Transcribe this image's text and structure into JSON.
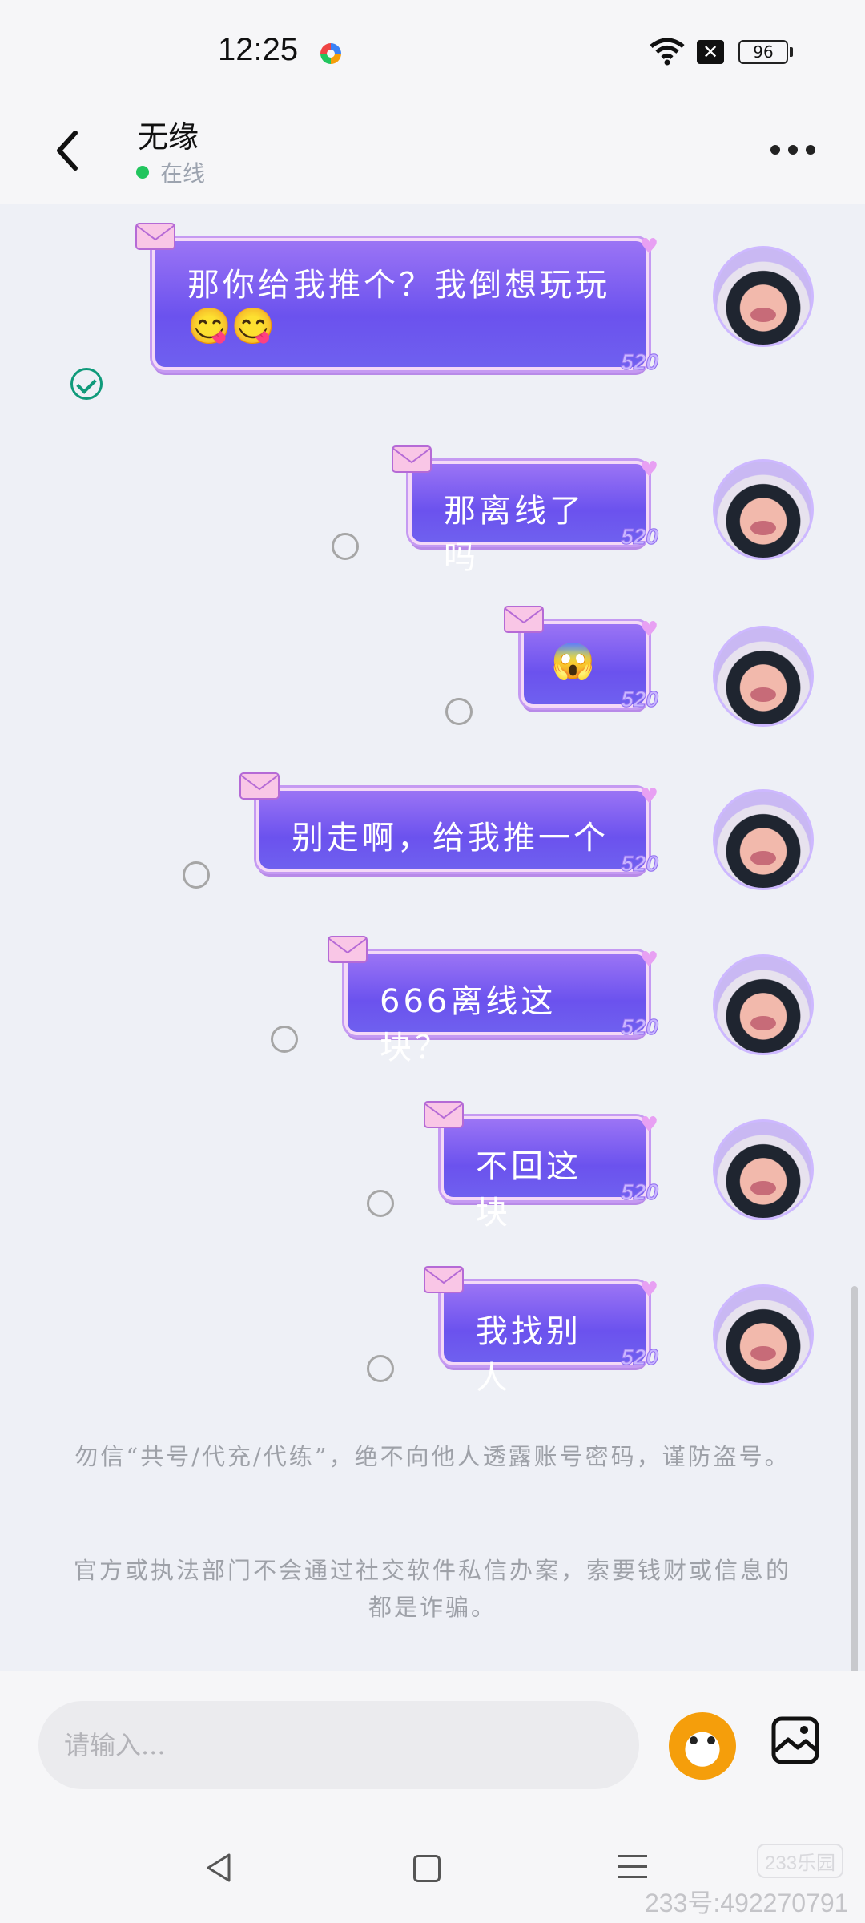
{
  "status_bar": {
    "time": "12:25",
    "battery": "96",
    "x_label": "✕"
  },
  "header": {
    "contact_name": "无缘",
    "online_status": "在线"
  },
  "messages": [
    {
      "text": "那你给我推个？我倒想玩玩",
      "emoji": "😋😋",
      "status": "read",
      "tag": "520"
    },
    {
      "text": "那离线了吗",
      "status": "sent",
      "tag": "520"
    },
    {
      "text": "😱",
      "status": "sent",
      "tag": "520"
    },
    {
      "text": "别走啊，给我推一个",
      "status": "sent",
      "tag": "520"
    },
    {
      "text": "666离线这块？",
      "status": "sent",
      "tag": "520"
    },
    {
      "text": "不回这块",
      "status": "sent",
      "tag": "520"
    },
    {
      "text": "我找别人",
      "status": "sent",
      "tag": "520"
    }
  ],
  "notices": [
    "勿信“共号/代充/代练”，绝不向他人透露账号密码，谨防盗号。",
    "官方或执法部门不会通过社交软件私信办案，索要钱财或信息的都是诈骗。"
  ],
  "input": {
    "placeholder": "请输入..."
  },
  "watermark": {
    "text": "233号:492270791",
    "logo": "233乐园"
  },
  "colors": {
    "bubble_top": "#9b74f5",
    "bubble_bottom": "#6b52ee",
    "online": "#22c55e",
    "read_check": "#0f9a7a"
  }
}
